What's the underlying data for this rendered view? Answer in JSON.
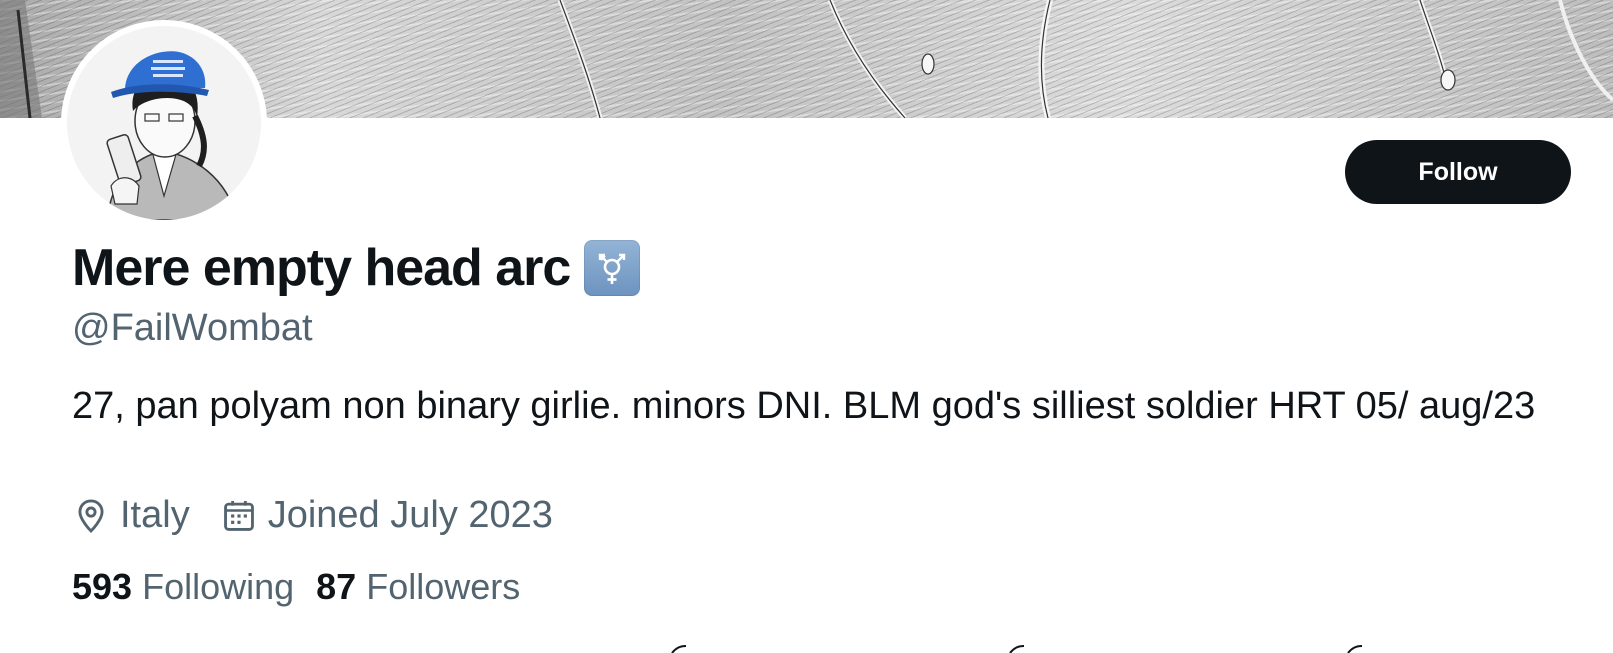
{
  "profile": {
    "display_name": "Mere empty head arc",
    "name_emoji": "transgender-symbol-icon",
    "handle": "@FailWombat",
    "bio": "27, pan polyam non binary girlie. minors DNI. BLM god's silliest soldier HRT 05/ aug/23",
    "location": "Italy",
    "joined": "Joined July 2023"
  },
  "actions": {
    "follow_label": "Follow"
  },
  "stats": {
    "following_count": "593",
    "following_label": "Following",
    "followers_count": "87",
    "followers_label": "Followers"
  },
  "icons": {
    "location": "location-pin-icon",
    "joined": "calendar-icon"
  },
  "colors": {
    "primary_text": "#0f1419",
    "secondary_text": "#536471",
    "follow_button_bg": "#0f1419",
    "follow_button_text": "#ffffff",
    "emoji_bg": "#7ea2ca"
  }
}
